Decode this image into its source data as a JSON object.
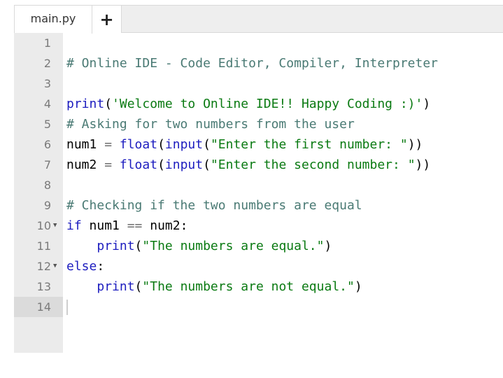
{
  "tabs": {
    "file_name": "main.py",
    "add_label": "+"
  },
  "editor": {
    "line_numbers": [
      "1",
      "2",
      "3",
      "4",
      "5",
      "6",
      "7",
      "8",
      "9",
      "10",
      "11",
      "12",
      "13",
      "14"
    ],
    "active_line": "14",
    "lines": {
      "l2": {
        "comment": "# Online IDE - Code Editor, Compiler, Interpreter"
      },
      "l4": {
        "fn": "print",
        "open": "(",
        "str": "'Welcome to Online IDE!! Happy Coding :)'",
        "close": ")"
      },
      "l5": {
        "comment": "# Asking for two numbers from the user"
      },
      "l6": {
        "var": "num1",
        "eq": " = ",
        "fn1": "float",
        "p1": "(",
        "fn2": "input",
        "p2": "(",
        "str": "\"Enter the first number: \"",
        "close": "))"
      },
      "l7": {
        "var": "num2",
        "eq": " = ",
        "fn1": "float",
        "p1": "(",
        "fn2": "input",
        "p2": "(",
        "str": "\"Enter the second number: \"",
        "close": "))"
      },
      "l9": {
        "comment": "# Checking if the two numbers are equal"
      },
      "l10": {
        "kw": "if",
        "a": " num1 ",
        "op": "==",
        "b": " num2:"
      },
      "l11": {
        "indent": "    ",
        "fn": "print",
        "open": "(",
        "str": "\"The numbers are equal.\"",
        "close": ")"
      },
      "l12": {
        "kw": "else",
        "colon": ":"
      },
      "l13": {
        "indent": "    ",
        "fn": "print",
        "open": "(",
        "str": "\"The numbers are not equal.\"",
        "close": ")"
      }
    },
    "fold_icon": "caret-down",
    "colors": {
      "comment": "#4a7a74",
      "function": "#1d1dbf",
      "string": "#0a7a12",
      "gutter": "#ebebeb",
      "active_gutter": "#dbdbdb"
    }
  }
}
